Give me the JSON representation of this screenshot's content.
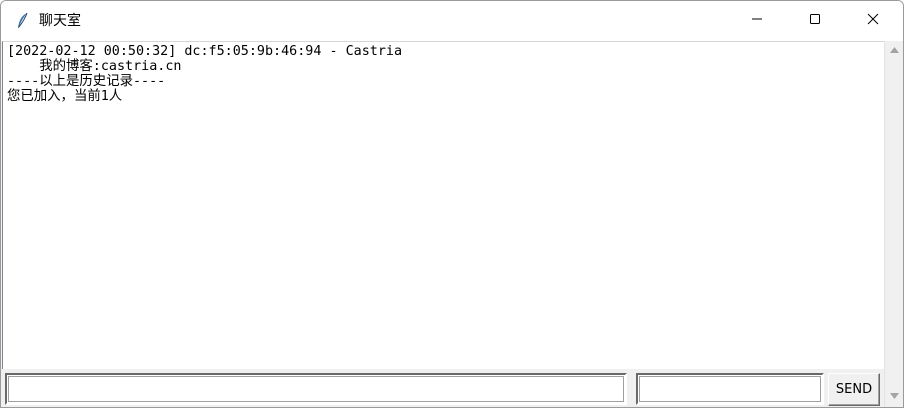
{
  "window": {
    "title": "聊天室",
    "controls": {
      "minimize": "minimize",
      "maximize": "maximize",
      "close": "close"
    }
  },
  "chat": {
    "lines": [
      "[2022-02-12 00:50:32] dc:f5:05:9b:46:94 - Castria",
      "    我的博客:castria.cn",
      "----以上是历史记录----",
      "您已加入，当前1人"
    ]
  },
  "input": {
    "message_value": "",
    "name_value": ""
  },
  "send_button": {
    "label": "SEND"
  },
  "icons": {
    "app": "feather-icon",
    "minimize": "minimize-icon",
    "maximize": "maximize-icon",
    "close": "close-icon",
    "scroll_up": "scroll-up-arrow-icon",
    "scroll_down": "scroll-down-arrow-icon"
  },
  "colors": {
    "titlebar": "#ffffff",
    "window_bg": "#f0f0f0",
    "text": "#000000"
  }
}
